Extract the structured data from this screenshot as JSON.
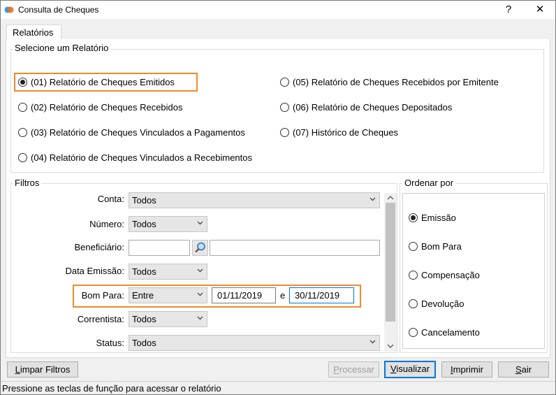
{
  "window": {
    "title": "Consulta de Cheques",
    "help_label": "?",
    "close_label": "✕"
  },
  "tab": {
    "label": "Relatórios"
  },
  "report_group": {
    "title": "Selecione um Relatório",
    "options": [
      {
        "label": "(01) Relatório de Cheques Emitidos",
        "selected": true
      },
      {
        "label": "(02) Relatório de Cheques Recebidos",
        "selected": false
      },
      {
        "label": "(03) Relatório de Cheques Vinculados a Pagamentos",
        "selected": false
      },
      {
        "label": "(04) Relatório de Cheques Vinculados a Recebimentos",
        "selected": false
      },
      {
        "label": "(05) Relatório de Cheques Recebidos por Emitente",
        "selected": false
      },
      {
        "label": "(06) Relatório de Cheques Depositados",
        "selected": false
      },
      {
        "label": "(07) Histórico de Cheques",
        "selected": false
      }
    ]
  },
  "filters": {
    "title": "Filtros",
    "conta": {
      "label": "Conta:",
      "value": "Todos"
    },
    "numero": {
      "label": "Número:",
      "value": "Todos"
    },
    "beneficiario": {
      "label": "Beneficiário:",
      "code": "",
      "name": ""
    },
    "data_emissao": {
      "label": "Data Emissão:",
      "value": "Todos"
    },
    "bom_para": {
      "label": "Bom Para:",
      "value": "Entre",
      "from": "01/11/2019",
      "conj": "e",
      "to": "30/11/2019"
    },
    "correntista": {
      "label": "Correntista:",
      "value": "Todos"
    },
    "status": {
      "label": "Status:",
      "value": "Todos"
    }
  },
  "order": {
    "title": "Ordenar por",
    "options": [
      {
        "label": "Emissão",
        "selected": true
      },
      {
        "label": "Bom Para",
        "selected": false
      },
      {
        "label": "Compensação",
        "selected": false
      },
      {
        "label": "Devolução",
        "selected": false
      },
      {
        "label": "Cancelamento",
        "selected": false
      }
    ]
  },
  "buttons": {
    "limpar_accel": "L",
    "limpar_rest": "impar Filtros",
    "processar_accel": "P",
    "processar_rest": "rocessar",
    "visualizar_accel": "V",
    "visualizar_rest": "isualizar",
    "imprimir_accel": "I",
    "imprimir_rest": "mprimir",
    "sair_accel": "S",
    "sair_rest": "air"
  },
  "status_bar": {
    "text": "Pressione as teclas de função para acessar o relatório"
  },
  "colors": {
    "highlight": "#f08a2a",
    "default_button_border": "#0078d7"
  }
}
